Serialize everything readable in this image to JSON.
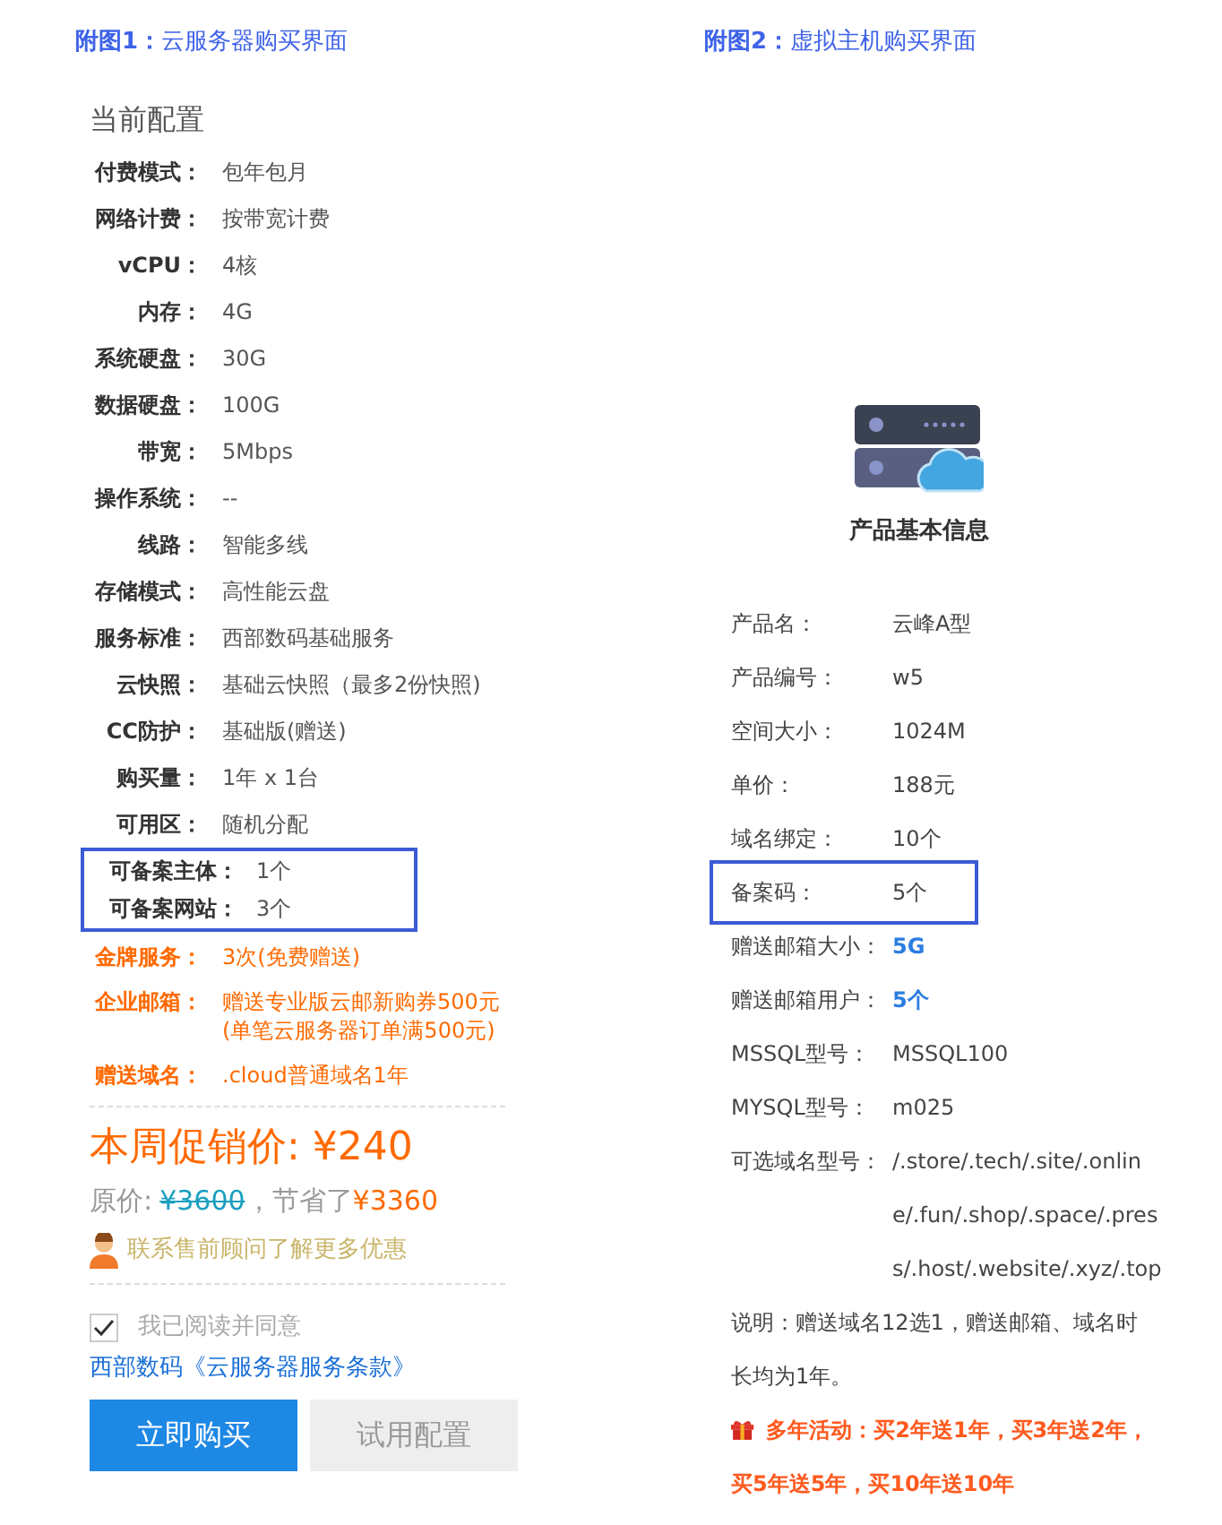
{
  "left": {
    "caption": "**附图1：**云服务器购买界面",
    "heading": "当前配置",
    "config_rows": [
      {
        "label": "付费模式：",
        "value": "包年包月"
      },
      {
        "label": "网络计费：",
        "value": "按带宽计费"
      },
      {
        "label": "vCPU：",
        "value": "4核"
      },
      {
        "label": "内存：",
        "value": "4G"
      },
      {
        "label": "系统硬盘：",
        "value": "30G"
      },
      {
        "label": "数据硬盘：",
        "value": "100G"
      },
      {
        "label": "带宽：",
        "value": "5Mbps"
      },
      {
        "label": "操作系统：",
        "value": "--"
      },
      {
        "label": "线路：",
        "value": "智能多线"
      },
      {
        "label": "存储模式：",
        "value": "高性能云盘"
      },
      {
        "label": "服务标准：",
        "value": "西部数码基础服务"
      },
      {
        "label": "云快照：",
        "value": "基础云快照（最多2份快照)"
      },
      {
        "label": "CC防护：",
        "value": "基础版(赠送)"
      },
      {
        "label": "购买量：",
        "value": "1年 x 1台"
      },
      {
        "label": "可用区：",
        "value": "随机分配"
      }
    ],
    "highlighted_rows": [
      {
        "label": "可备案主体：",
        "value": "1个"
      },
      {
        "label": "可备案网站：",
        "value": "3个"
      }
    ],
    "gift_rows": [
      {
        "label": "金牌服务：",
        "value_lines": [
          "3次(免费赠送)"
        ]
      },
      {
        "label": "企业邮箱：",
        "value_lines": [
          "赠送专业版云邮新购券500元",
          "(单笔云服务器订单满500元)"
        ]
      },
      {
        "label": "赠送域名：",
        "value_lines": [
          ".cloud普通域名1年"
        ]
      }
    ],
    "promo_price": "本周促销价: ¥240",
    "original_label": "原价:",
    "original_price": "¥3600",
    "saved_label": "，节省了",
    "saved_amount": "¥3360",
    "contact": "联系售前顾问了解更多优惠",
    "agree": {
      "checked": true,
      "label": "我已阅读并同意"
    },
    "terms_link": "西部数码《云服务器服务条款》",
    "buttons": [
      {
        "label": "立即购买",
        "kind": "primary"
      },
      {
        "label": "试用配置",
        "kind": "secondary"
      }
    ]
  },
  "right": {
    "caption": "**附图2：**虚拟主机购买界面",
    "heading": "产品基本信息",
    "info_rows": [
      {
        "label": "产品名：",
        "value_lines": [
          "云峰A型"
        ],
        "kind": "plain"
      },
      {
        "label": "产品编号：",
        "value_lines": [
          "w5"
        ],
        "kind": "plain"
      },
      {
        "label": "空间大小：",
        "value_lines": [
          "1024M"
        ],
        "kind": "plain"
      },
      {
        "label": "单价：",
        "value_lines": [
          "188元"
        ],
        "kind": "plain"
      },
      {
        "label": "域名绑定：",
        "value_lines": [
          "10个"
        ],
        "kind": "plain"
      },
      {
        "label": "备案码：",
        "value_lines": [
          "5个"
        ],
        "kind": "boxed"
      },
      {
        "label": "赠送邮箱大小：",
        "value_lines": [
          "5G"
        ],
        "kind": "emphasis"
      },
      {
        "label": "赠送邮箱用户：",
        "value_lines": [
          "5个"
        ],
        "kind": "emphasis"
      },
      {
        "label": "MSSQL型号：",
        "value_lines": [
          "MSSQL100"
        ],
        "kind": "plain"
      },
      {
        "label": "MYSQL型号：",
        "value_lines": [
          "m025"
        ],
        "kind": "plain"
      },
      {
        "label": "可选域名型号：",
        "value_lines": [
          "/.store/.tech/.site/.onlin",
          "e/.fun/.shop/.space/.pres",
          "s/.host/.website/.xyz/.top"
        ],
        "kind": "plain"
      }
    ],
    "note_lines": [
      "说明：赠送域名12选1，赠送邮箱、域名时",
      "长均为1年。"
    ],
    "promo_lines": [
      "多年活动：买2年送1年，买3年送2年，",
      "买5年送5年，买10年送10年"
    ]
  }
}
